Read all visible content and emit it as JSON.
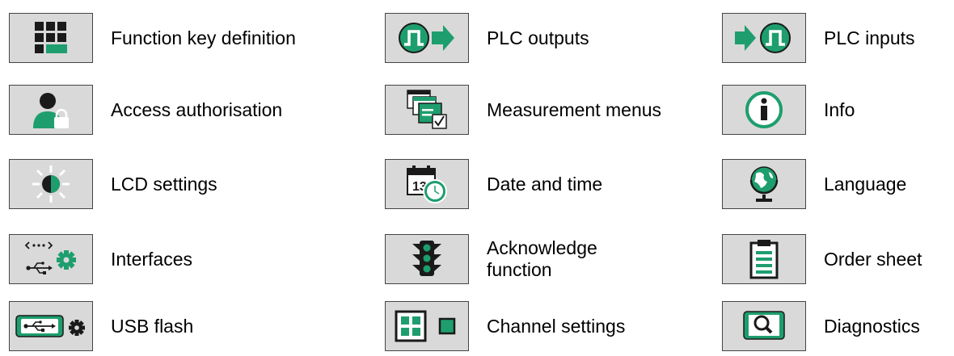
{
  "colors": {
    "accent": "#1e9e6e",
    "button_bg": "#d9d9d9",
    "border": "#444444"
  },
  "menu": {
    "function_key_definition": {
      "label": "Function key definition",
      "icon": "keypad-icon"
    },
    "plc_outputs": {
      "label": "PLC outputs",
      "icon": "plc-output-icon"
    },
    "plc_inputs": {
      "label": "PLC inputs",
      "icon": "plc-input-icon"
    },
    "access_authorisation": {
      "label": "Access authorisation",
      "icon": "user-lock-icon"
    },
    "measurement_menus": {
      "label": "Measurement menus",
      "icon": "windows-check-icon"
    },
    "info": {
      "label": "Info",
      "icon": "info-icon"
    },
    "lcd_settings": {
      "label": "LCD settings",
      "icon": "brightness-icon"
    },
    "date_and_time": {
      "label": "Date and time",
      "icon": "calendar-clock-icon"
    },
    "language": {
      "label": "Language",
      "icon": "globe-icon"
    },
    "interfaces": {
      "label": "Interfaces",
      "icon": "interfaces-gear-icon"
    },
    "acknowledge_function": {
      "label": "Acknowledge function",
      "icon": "traffic-light-icon"
    },
    "order_sheet": {
      "label": "Order sheet",
      "icon": "clipboard-icon"
    },
    "usb_flash": {
      "label": "USB flash",
      "icon": "usb-flash-icon"
    },
    "channel_settings": {
      "label": "Channel settings",
      "icon": "channel-grid-icon"
    },
    "diagnostics": {
      "label": "Diagnostics",
      "icon": "magnifier-screen-icon"
    }
  }
}
